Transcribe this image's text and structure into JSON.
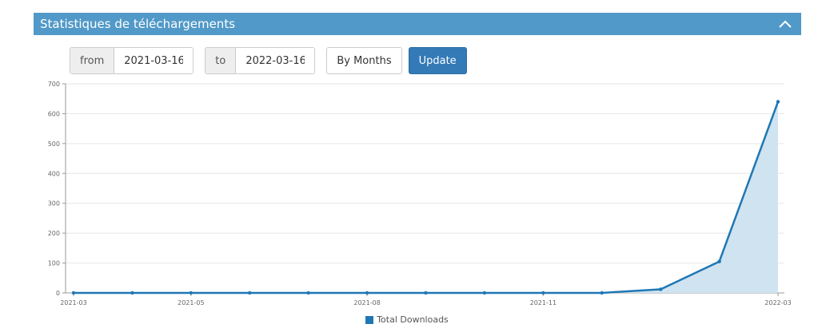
{
  "panel": {
    "title": "Statistiques de téléchargements"
  },
  "controls": {
    "from_label": "from",
    "from_value": "2021-03-16",
    "to_label": "to",
    "to_value": "2022-03-16",
    "group_button": "By Months",
    "update_button": "Update"
  },
  "colors": {
    "header": "#5199c8",
    "series": "#1f77b4",
    "area": "#d0e3f1",
    "primary_button": "#337ab7"
  },
  "chart_data": {
    "type": "area",
    "x": [
      "2021-03",
      "2021-04",
      "2021-05",
      "2021-06",
      "2021-07",
      "2021-08",
      "2021-09",
      "2021-10",
      "2021-11",
      "2021-12",
      "2022-01",
      "2022-02",
      "2022-03"
    ],
    "x_tick_labels": [
      "2021-03",
      "2021-05",
      "2021-08",
      "2021-11",
      "2022-03"
    ],
    "series": [
      {
        "name": "Total Downloads",
        "values": [
          0,
          0,
          0,
          0,
          0,
          0,
          0,
          0,
          0,
          0,
          12,
          105,
          640
        ]
      }
    ],
    "yticks": [
      0,
      100,
      200,
      300,
      400,
      500,
      600,
      700
    ],
    "ylim": [
      0,
      700
    ],
    "grid": true,
    "legend": "bottom-center"
  }
}
